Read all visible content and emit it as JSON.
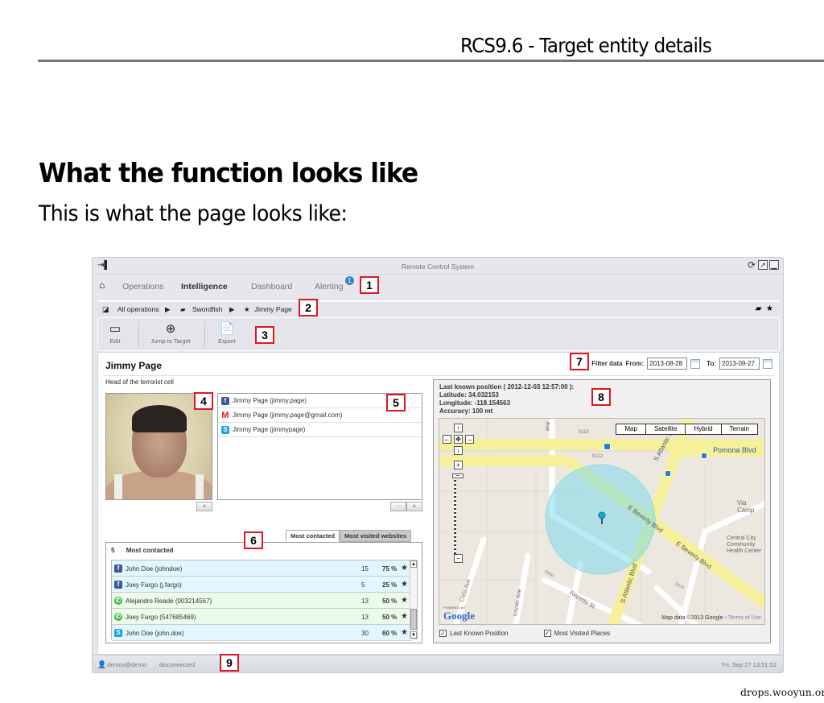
{
  "document": {
    "header_title": "RCS9.6 - Target entity details",
    "heading": "What the function looks like",
    "paragraph": "This is what the page looks like:",
    "footer_source": "drops.wooyun.org"
  },
  "app": {
    "title": "Remote Control System",
    "nav": {
      "tabs": [
        "Operations",
        "Intelligence",
        "Dashboard",
        "Alerting"
      ],
      "active_tab": "Intelligence",
      "alerting_badge": "1"
    },
    "breadcrumb": [
      "All operations",
      "Swordfish",
      "Jimmy Page"
    ],
    "toolbar": {
      "edit": "Edit",
      "jump_to_target": "Jump to Target",
      "export": "Export"
    },
    "entity": {
      "name": "Jimmy Page",
      "description": "Head of the terrorist cell"
    },
    "filter": {
      "label": "Filter data",
      "from_label": "From:",
      "from_value": "2013-08-28",
      "to_label": "To:",
      "to_value": "2013-09-27"
    },
    "accounts": [
      {
        "service": "facebook",
        "label": "Jimmy Page (jimmy.page)"
      },
      {
        "service": "gmail",
        "label": "Jimmy Page (jimmy.page@gmail.com)"
      },
      {
        "service": "skype",
        "label": "Jimmy Page (jimmypage)"
      }
    ],
    "buttons": {
      "plus": "+",
      "minus": "-"
    },
    "contacts_tabs": [
      "Most contacted",
      "Most visited websites"
    ],
    "contacts_header": {
      "count": "5",
      "title": "Most contacted"
    },
    "contacts": [
      {
        "service": "facebook",
        "name": "John Doe (johndoe)",
        "count": "15",
        "percent": "75 %"
      },
      {
        "service": "facebook",
        "name": "Joey Fargo (j.fargo)",
        "count": "5",
        "percent": "25 %"
      },
      {
        "service": "whatsapp",
        "name": "Alejandro Reade (003214567)",
        "count": "13",
        "percent": "50 %"
      },
      {
        "service": "whatsapp",
        "name": "Joey Fargo (547685469)",
        "count": "13",
        "percent": "50 %"
      },
      {
        "service": "skype",
        "name": "John Doe (john.doe)",
        "count": "30",
        "percent": "60 %"
      }
    ],
    "position": {
      "title": "Last known position ( 2012-12-03 12:57:00 ):",
      "latitude": "Latitude: 34.032153",
      "longitude": "Longitude: -118.154563",
      "accuracy": "Accuracy: 100 mt"
    },
    "map": {
      "types": [
        "Map",
        "Satellite",
        "Hybrid",
        "Terrain"
      ],
      "labels": {
        "e_beverly_blvd": "E Beverly Blvd",
        "s_atlantic_blvd": "S Atlantic Blvd",
        "pomona_blvd": "Pomona Blvd",
        "via_campo": "Via Camp",
        "health_center": "Central City Community Health Center",
        "repetto_st": "Repetto St",
        "ciela_ave": "Ciela Ave",
        "vancouver_ave": "couver Ave",
        "ave_top": "Ave",
        "num_5115": "5115",
        "num_5122": "5122",
        "num_5000": "5000",
        "num_5270": "5270"
      },
      "powered_by": "POWERED BY",
      "google": "Google",
      "attribution": "Map data ©2013  Google - ",
      "terms": "Terms of Use"
    },
    "map_checks": [
      {
        "label": "Last Known Position",
        "checked": true
      },
      {
        "label": "Most Visited Places",
        "checked": true
      }
    ],
    "status": {
      "user": "demov@demo",
      "connection": "disconnected",
      "datetime": "Fri, Sep 27   13:51:52"
    },
    "callouts": [
      "1",
      "2",
      "3",
      "4",
      "5",
      "6",
      "7",
      "8",
      "9"
    ]
  }
}
